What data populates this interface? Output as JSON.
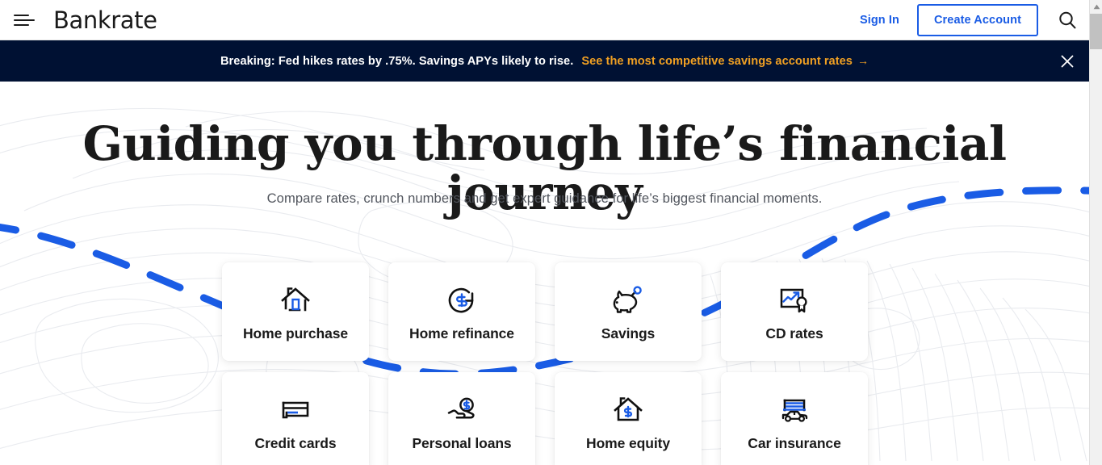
{
  "header": {
    "menu_icon": "hamburger-menu-icon",
    "brand": "Bankrate",
    "sign_in": "Sign In",
    "create_account": "Create Account",
    "search_icon": "search-icon",
    "accent_blue": "#1a5ce5"
  },
  "banner": {
    "text": "Breaking: Fed hikes rates by .75%. Savings APYs likely to rise.",
    "link": "See the most competitive savings account rates",
    "link_arrow": "→",
    "close_icon": "close-icon",
    "background": "#001133",
    "link_color": "#f0a023"
  },
  "hero": {
    "title": "Guiding you through life’s financial journey",
    "subtitle": "Compare rates, crunch numbers and get expert guidance for life’s biggest financial moments.",
    "path_color": "#1a5ce5"
  },
  "cards": [
    {
      "label": "Home purchase",
      "icon": "house-with-door-icon"
    },
    {
      "label": "Home refinance",
      "icon": "refresh-dollar-icon"
    },
    {
      "label": "Savings",
      "icon": "piggy-bank-icon"
    },
    {
      "label": "CD rates",
      "icon": "chart-award-icon"
    },
    {
      "label": "Credit cards",
      "icon": "credit-card-icon"
    },
    {
      "label": "Personal loans",
      "icon": "hand-holding-coin-icon"
    },
    {
      "label": "Home equity",
      "icon": "house-dollar-icon"
    },
    {
      "label": "Car insurance",
      "icon": "car-shelter-icon"
    }
  ],
  "scrollbar": {
    "up_arrow": "▲"
  }
}
